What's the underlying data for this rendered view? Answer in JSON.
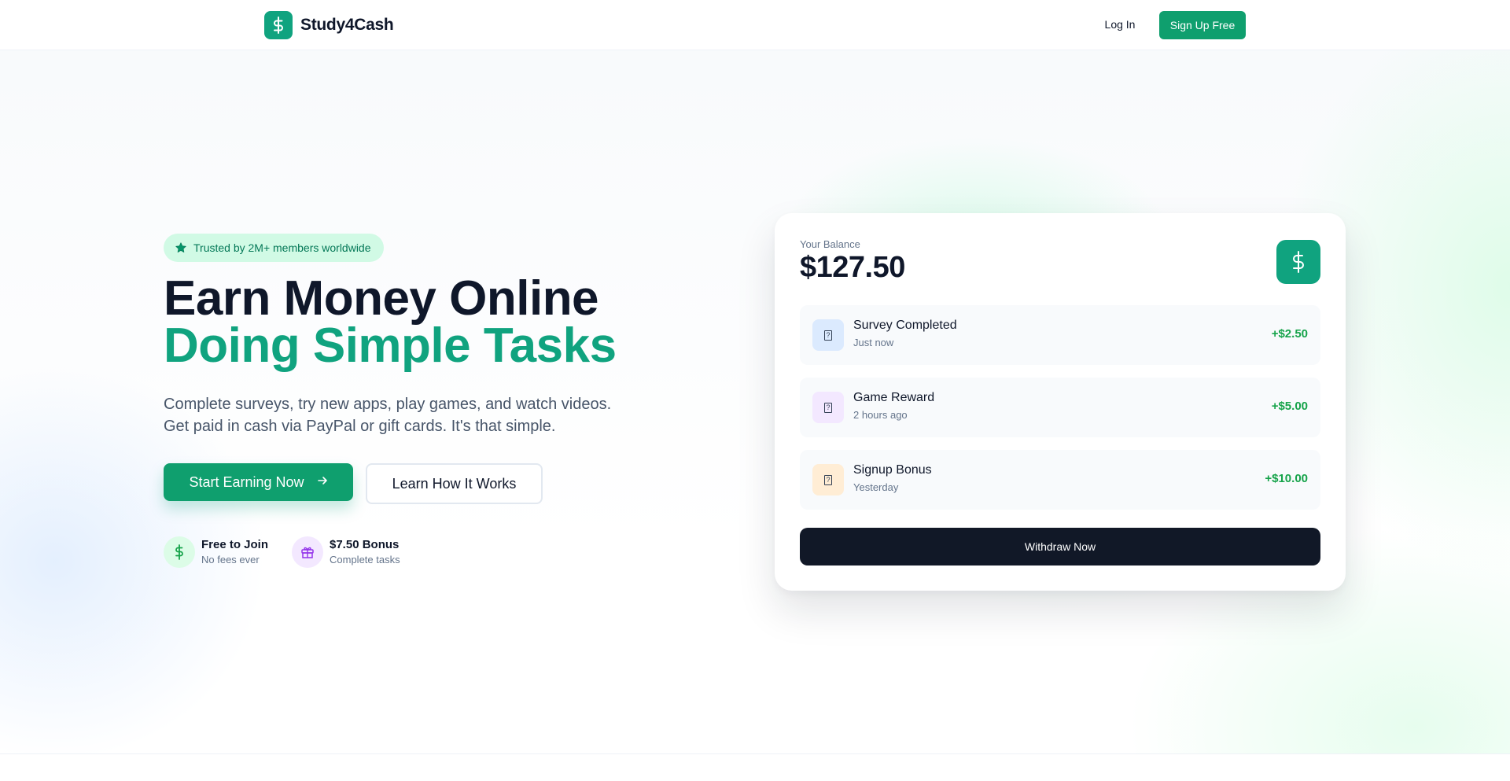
{
  "header": {
    "logo_text": "Study4Cash",
    "login_label": "Log In",
    "signup_label": "Sign Up Free"
  },
  "hero": {
    "badge_text": "Trusted by 2M+ members worldwide",
    "headline_line1": "Earn Money Online",
    "headline_line2": "Doing Simple Tasks",
    "subtext_line1": "Complete surveys, try new apps, play games, and watch videos.",
    "subtext_line2": "Get paid in cash via PayPal or gift cards. It's that simple.",
    "primary_button": "Start Earning Now",
    "secondary_button": "Learn How It Works",
    "features": [
      {
        "title": "Free to Join",
        "subtitle": "No fees ever",
        "icon": "dollar-icon"
      },
      {
        "title": "$7.50 Bonus",
        "subtitle": "Complete tasks",
        "icon": "gift-icon"
      }
    ]
  },
  "card": {
    "balance_label": "Your Balance",
    "balance_amount": "$127.50",
    "transactions": [
      {
        "title": "Survey Completed",
        "time": "Just now",
        "amount": "+$2.50",
        "icon_bg": "#dbeafe"
      },
      {
        "title": "Game Reward",
        "time": "2 hours ago",
        "amount": "+$5.00",
        "icon_bg": "#f3e8ff"
      },
      {
        "title": "Signup Bonus",
        "time": "Yesterday",
        "amount": "+$10.00",
        "icon_bg": "#ffedd5"
      }
    ],
    "withdraw_label": "Withdraw Now"
  },
  "colors": {
    "brand_green": "#10a37f",
    "button_green": "#0f9f6e",
    "amount_green": "#16a34a",
    "dark": "#111827"
  }
}
